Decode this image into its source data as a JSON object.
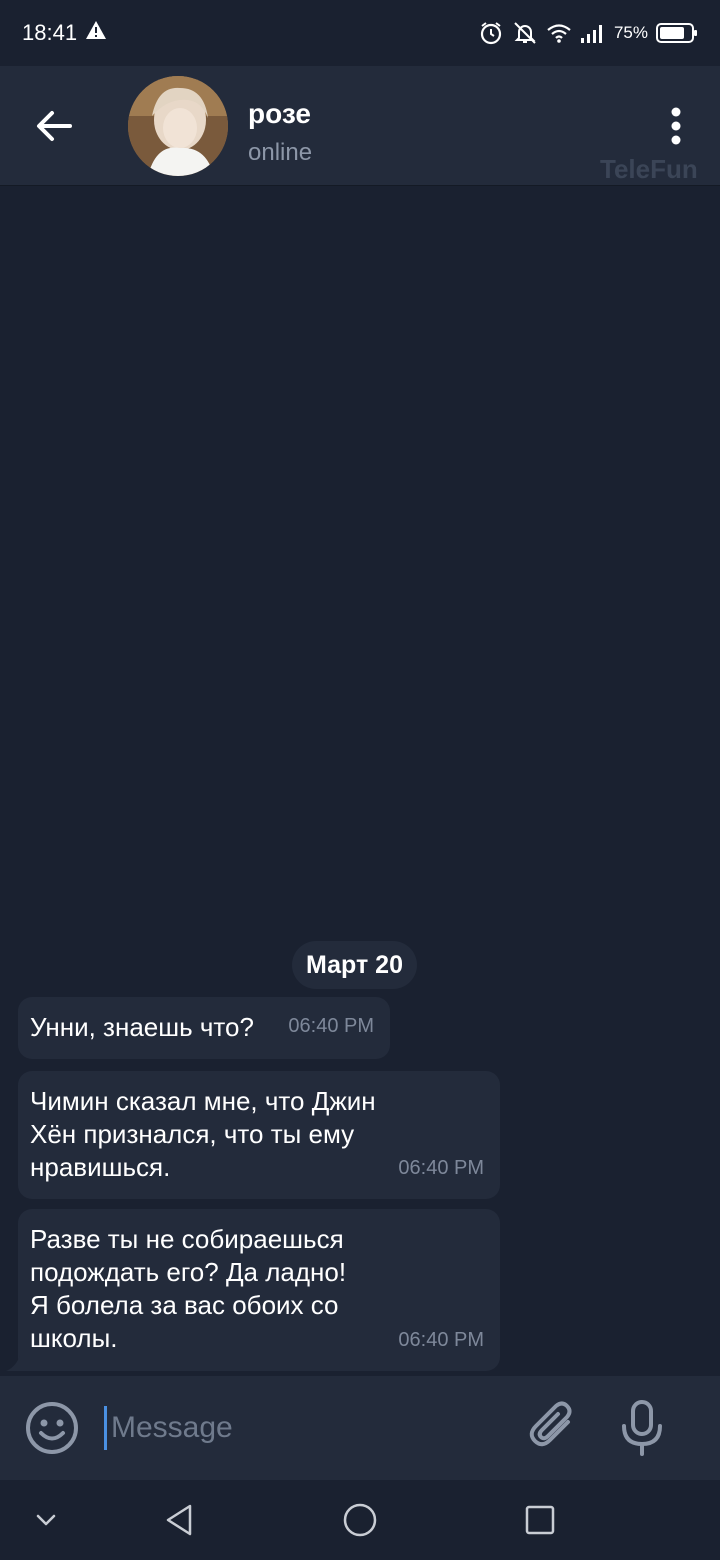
{
  "status_bar": {
    "time": "18:41",
    "battery": "75%"
  },
  "header": {
    "title": "розе",
    "status": "online",
    "watermark": "TeleFun"
  },
  "chat": {
    "date_chip": "Март 20",
    "messages": [
      {
        "text": "Унни, знаешь что?",
        "time": "06:40 PM"
      },
      {
        "text": "Чимин сказал мне, что Джин\nХён признался, что ты ему\nнравишься.",
        "time": "06:40 PM"
      },
      {
        "text": "Разве ты не собираешься\nподождать его? Да ладно!\nЯ болела за вас обоих со\nшколы.",
        "time": "06:40 PM"
      }
    ]
  },
  "input": {
    "placeholder": "Message"
  },
  "colors": {
    "background": "#1a2130",
    "bar": "#232b3b",
    "bubble": "#232b3b",
    "secondary_text": "#8d97a8",
    "cursor": "#4a90e2"
  }
}
